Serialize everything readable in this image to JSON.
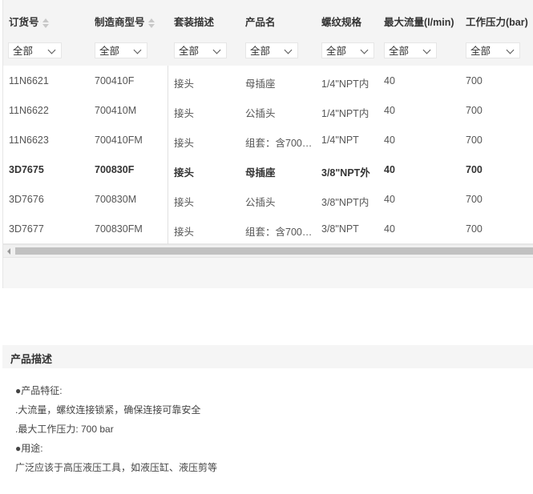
{
  "columns": [
    {
      "label": "订货号",
      "sortable": true
    },
    {
      "label": "制造商型号",
      "sortable": true
    },
    {
      "label": "套装描述",
      "sortable": false
    },
    {
      "label": "产品名",
      "sortable": false
    },
    {
      "label": "螺纹规格",
      "sortable": false
    },
    {
      "label": "最大流量(l/min)",
      "sortable": false
    },
    {
      "label": "工作压力(bar)",
      "sortable": false
    }
  ],
  "filters": [
    "全部",
    "全部",
    "全部",
    "全部",
    "全部",
    "全部",
    "全部"
  ],
  "rows": [
    {
      "cells": [
        "11N6621",
        "700410F",
        "接头",
        "母插座",
        "1/4\"NPT内",
        "40",
        "700"
      ],
      "bold": false
    },
    {
      "cells": [
        "11N6622",
        "700410M",
        "接头",
        "公插头",
        "1/4\"NPT内",
        "40",
        "700"
      ],
      "bold": false
    },
    {
      "cells": [
        "11N6623",
        "700410FM",
        "接头",
        "组套：含700…",
        "1/4\"NPT",
        "40",
        "700"
      ],
      "bold": false
    },
    {
      "cells": [
        "3D7675",
        "700830F",
        "接头",
        "母插座",
        "3/8\"NPT外",
        "40",
        "700"
      ],
      "bold": true
    },
    {
      "cells": [
        "3D7676",
        "700830M",
        "接头",
        "公插头",
        "3/8\"NPT内",
        "40",
        "700"
      ],
      "bold": false
    },
    {
      "cells": [
        "3D7677",
        "700830FM",
        "接头",
        "组套：含700…",
        "3/8\"NPT",
        "40",
        "700"
      ],
      "bold": false
    }
  ],
  "description": {
    "title": "产品描述",
    "lines": [
      "●产品特征:",
      ".大流量，螺纹连接锁紧，确保连接可靠安全",
      ".最大工作压力: 700 bar",
      "●用途:",
      "广泛应该于高压液压工具，如液压缸、液压剪等"
    ]
  }
}
